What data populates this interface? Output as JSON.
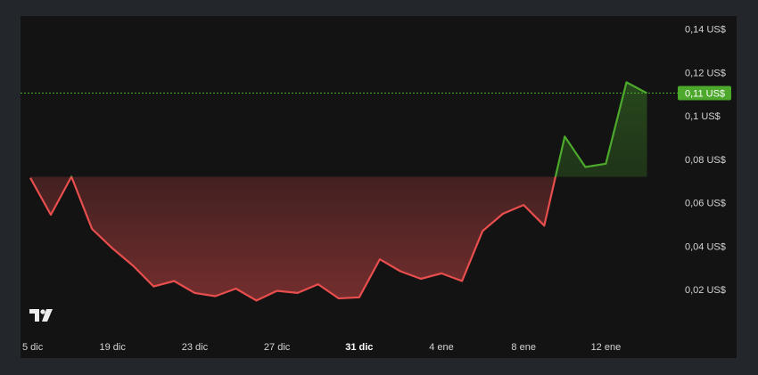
{
  "chart_data": {
    "type": "line",
    "baseline": 0.072,
    "last_price_label": "0,11 US$",
    "y_ticks": [
      {
        "value": 0.14,
        "label": "0,14 US$"
      },
      {
        "value": 0.12,
        "label": "0,12 US$"
      },
      {
        "value": 0.1,
        "label": "0,1 US$"
      },
      {
        "value": 0.08,
        "label": "0,08 US$"
      },
      {
        "value": 0.06,
        "label": "0,06 US$"
      },
      {
        "value": 0.04,
        "label": "0,04 US$"
      },
      {
        "value": 0.02,
        "label": "0,02 US$"
      }
    ],
    "x_ticks": [
      {
        "index": 0,
        "label": "5 dic",
        "bold": false
      },
      {
        "index": 4,
        "label": "19 dic",
        "bold": false
      },
      {
        "index": 8,
        "label": "23 dic",
        "bold": false
      },
      {
        "index": 12,
        "label": "27 dic",
        "bold": false
      },
      {
        "index": 16,
        "label": "31 dic",
        "bold": true
      },
      {
        "index": 20,
        "label": "4 ene",
        "bold": false
      },
      {
        "index": 24,
        "label": "8 ene",
        "bold": false
      },
      {
        "index": 28,
        "label": "12 ene",
        "bold": false
      }
    ],
    "values": [
      0.0715,
      0.0545,
      0.072,
      0.048,
      0.039,
      0.031,
      0.0215,
      0.024,
      0.0185,
      0.017,
      0.0205,
      0.015,
      0.0195,
      0.0185,
      0.0225,
      0.016,
      0.0165,
      0.034,
      0.0285,
      0.025,
      0.0275,
      0.024,
      0.047,
      0.055,
      0.059,
      0.0495,
      0.0905,
      0.0765,
      0.078,
      0.1155,
      0.1105
    ],
    "ylim": [
      0,
      0.146
    ],
    "colors": {
      "up": "#4ca92c",
      "down": "#e94e4e",
      "text": "#d4d4d4",
      "price_tag": "#4ca92c"
    },
    "watermark_icon": "tradingview-logo-icon"
  }
}
